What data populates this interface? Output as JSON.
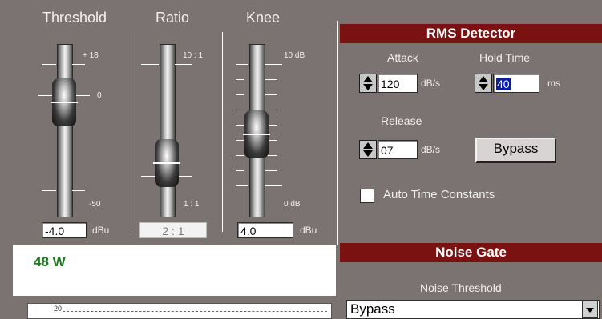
{
  "compressor": {
    "threshold": {
      "title": "Threshold",
      "top_label": "+ 18",
      "mid_label": "0",
      "bottom_label": "-50",
      "value": "-4.0",
      "unit": "dBu"
    },
    "ratio": {
      "title": "Ratio",
      "top_label": "10 : 1",
      "bottom_label": "1 : 1",
      "value": "2 : 1"
    },
    "knee": {
      "title": "Knee",
      "top_label": "10 dB",
      "bottom_label": "0 dB",
      "value": "4.0",
      "unit": "dBu"
    },
    "power_display": "48 W",
    "meter_top_label": "20"
  },
  "rms": {
    "title": "RMS Detector",
    "attack_label": "Attack",
    "attack_value": "120",
    "attack_unit": "dB/s",
    "hold_label": "Hold Time",
    "hold_value": "40",
    "hold_unit": "ms",
    "release_label": "Release",
    "release_value": "07",
    "release_unit": "dB/s",
    "bypass_label": "Bypass",
    "auto_label": "Auto Time Constants"
  },
  "noise_gate": {
    "title": "Noise Gate",
    "threshold_label": "Noise Threshold",
    "threshold_value": "Bypass"
  },
  "colors": {
    "background": "#7a7372",
    "header_bar": "#7b1212",
    "power_text": "#1c7a1c"
  }
}
